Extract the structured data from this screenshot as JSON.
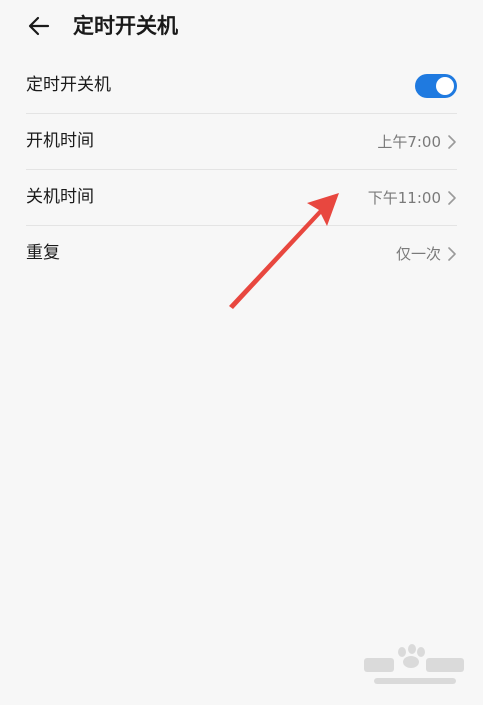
{
  "header": {
    "title": "定时开关机",
    "back_icon": "arrow-left-icon"
  },
  "settings": {
    "power_schedule": {
      "label": "定时开关机",
      "enabled": true
    },
    "power_on_time": {
      "label": "开机时间",
      "value": "上午7:00"
    },
    "power_off_time": {
      "label": "关机时间",
      "value": "下午11:00"
    },
    "repeat": {
      "label": "重复",
      "value": "仅一次"
    }
  },
  "colors": {
    "accent": "#1f7ae0",
    "annotation_arrow": "#e8473f",
    "background": "#f7f7f7"
  },
  "annotation": {
    "icon": "red-pointer-arrow-icon"
  },
  "watermark": {
    "icon": "baidu-jingyan-watermark-icon"
  }
}
